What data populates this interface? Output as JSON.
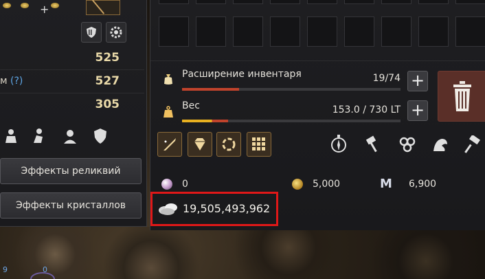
{
  "left_panel": {
    "plus_left": "+",
    "plus_right": "+",
    "stats": [
      {
        "label": "",
        "help": "",
        "value": "525"
      },
      {
        "label": "м",
        "help": "(?)",
        "value": "527"
      },
      {
        "label": "",
        "help": "",
        "value": "305"
      }
    ],
    "relic_effects_button": "Эффекты реликвий",
    "crystal_effects_button": "Эффекты кристаллов"
  },
  "inventory": {
    "expansion_label": "Расширение инвентаря",
    "expansion_value": "19/74",
    "expansion_progress": 0.26,
    "weight_label": "Вес",
    "weight_value": "153.0 / 730 LT",
    "weight_progress": 0.21,
    "plus": "+"
  },
  "currency": {
    "pearl_value": "0",
    "gold_coin_value": "5,000",
    "m_value": "6,900",
    "m_symbol": "M",
    "silver_value": "19,505,493,962"
  },
  "bottom": {
    "num_left": "9",
    "num_right": "0"
  },
  "colors": {
    "highlight_border": "#e01818",
    "expansion_bar": "#c0432c",
    "weight_bar_a": "#e8b020",
    "weight_bar_b": "#c0432c",
    "trash_bg": "#5a2f28"
  }
}
